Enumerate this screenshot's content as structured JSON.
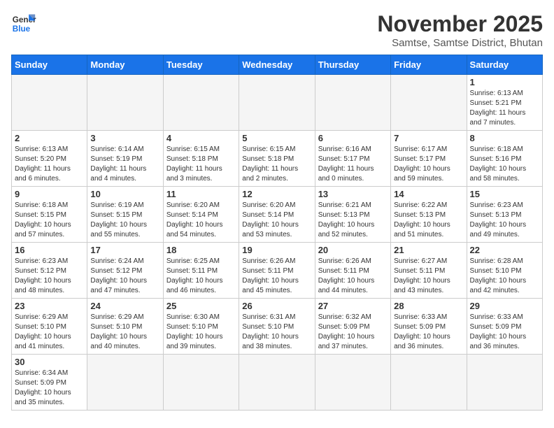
{
  "header": {
    "logo_line1": "General",
    "logo_line2": "Blue",
    "month_title": "November 2025",
    "subtitle": "Samtse, Samtse District, Bhutan"
  },
  "days_of_week": [
    "Sunday",
    "Monday",
    "Tuesday",
    "Wednesday",
    "Thursday",
    "Friday",
    "Saturday"
  ],
  "weeks": [
    [
      {
        "day": "",
        "info": ""
      },
      {
        "day": "",
        "info": ""
      },
      {
        "day": "",
        "info": ""
      },
      {
        "day": "",
        "info": ""
      },
      {
        "day": "",
        "info": ""
      },
      {
        "day": "",
        "info": ""
      },
      {
        "day": "1",
        "info": "Sunrise: 6:13 AM\nSunset: 5:21 PM\nDaylight: 11 hours\nand 7 minutes."
      }
    ],
    [
      {
        "day": "2",
        "info": "Sunrise: 6:13 AM\nSunset: 5:20 PM\nDaylight: 11 hours\nand 6 minutes."
      },
      {
        "day": "3",
        "info": "Sunrise: 6:14 AM\nSunset: 5:19 PM\nDaylight: 11 hours\nand 4 minutes."
      },
      {
        "day": "4",
        "info": "Sunrise: 6:15 AM\nSunset: 5:18 PM\nDaylight: 11 hours\nand 3 minutes."
      },
      {
        "day": "5",
        "info": "Sunrise: 6:15 AM\nSunset: 5:18 PM\nDaylight: 11 hours\nand 2 minutes."
      },
      {
        "day": "6",
        "info": "Sunrise: 6:16 AM\nSunset: 5:17 PM\nDaylight: 11 hours\nand 0 minutes."
      },
      {
        "day": "7",
        "info": "Sunrise: 6:17 AM\nSunset: 5:17 PM\nDaylight: 10 hours\nand 59 minutes."
      },
      {
        "day": "8",
        "info": "Sunrise: 6:18 AM\nSunset: 5:16 PM\nDaylight: 10 hours\nand 58 minutes."
      }
    ],
    [
      {
        "day": "9",
        "info": "Sunrise: 6:18 AM\nSunset: 5:15 PM\nDaylight: 10 hours\nand 57 minutes."
      },
      {
        "day": "10",
        "info": "Sunrise: 6:19 AM\nSunset: 5:15 PM\nDaylight: 10 hours\nand 55 minutes."
      },
      {
        "day": "11",
        "info": "Sunrise: 6:20 AM\nSunset: 5:14 PM\nDaylight: 10 hours\nand 54 minutes."
      },
      {
        "day": "12",
        "info": "Sunrise: 6:20 AM\nSunset: 5:14 PM\nDaylight: 10 hours\nand 53 minutes."
      },
      {
        "day": "13",
        "info": "Sunrise: 6:21 AM\nSunset: 5:13 PM\nDaylight: 10 hours\nand 52 minutes."
      },
      {
        "day": "14",
        "info": "Sunrise: 6:22 AM\nSunset: 5:13 PM\nDaylight: 10 hours\nand 51 minutes."
      },
      {
        "day": "15",
        "info": "Sunrise: 6:23 AM\nSunset: 5:13 PM\nDaylight: 10 hours\nand 49 minutes."
      }
    ],
    [
      {
        "day": "16",
        "info": "Sunrise: 6:23 AM\nSunset: 5:12 PM\nDaylight: 10 hours\nand 48 minutes."
      },
      {
        "day": "17",
        "info": "Sunrise: 6:24 AM\nSunset: 5:12 PM\nDaylight: 10 hours\nand 47 minutes."
      },
      {
        "day": "18",
        "info": "Sunrise: 6:25 AM\nSunset: 5:11 PM\nDaylight: 10 hours\nand 46 minutes."
      },
      {
        "day": "19",
        "info": "Sunrise: 6:26 AM\nSunset: 5:11 PM\nDaylight: 10 hours\nand 45 minutes."
      },
      {
        "day": "20",
        "info": "Sunrise: 6:26 AM\nSunset: 5:11 PM\nDaylight: 10 hours\nand 44 minutes."
      },
      {
        "day": "21",
        "info": "Sunrise: 6:27 AM\nSunset: 5:11 PM\nDaylight: 10 hours\nand 43 minutes."
      },
      {
        "day": "22",
        "info": "Sunrise: 6:28 AM\nSunset: 5:10 PM\nDaylight: 10 hours\nand 42 minutes."
      }
    ],
    [
      {
        "day": "23",
        "info": "Sunrise: 6:29 AM\nSunset: 5:10 PM\nDaylight: 10 hours\nand 41 minutes."
      },
      {
        "day": "24",
        "info": "Sunrise: 6:29 AM\nSunset: 5:10 PM\nDaylight: 10 hours\nand 40 minutes."
      },
      {
        "day": "25",
        "info": "Sunrise: 6:30 AM\nSunset: 5:10 PM\nDaylight: 10 hours\nand 39 minutes."
      },
      {
        "day": "26",
        "info": "Sunrise: 6:31 AM\nSunset: 5:10 PM\nDaylight: 10 hours\nand 38 minutes."
      },
      {
        "day": "27",
        "info": "Sunrise: 6:32 AM\nSunset: 5:09 PM\nDaylight: 10 hours\nand 37 minutes."
      },
      {
        "day": "28",
        "info": "Sunrise: 6:33 AM\nSunset: 5:09 PM\nDaylight: 10 hours\nand 36 minutes."
      },
      {
        "day": "29",
        "info": "Sunrise: 6:33 AM\nSunset: 5:09 PM\nDaylight: 10 hours\nand 36 minutes."
      }
    ],
    [
      {
        "day": "30",
        "info": "Sunrise: 6:34 AM\nSunset: 5:09 PM\nDaylight: 10 hours\nand 35 minutes."
      },
      {
        "day": "",
        "info": ""
      },
      {
        "day": "",
        "info": ""
      },
      {
        "day": "",
        "info": ""
      },
      {
        "day": "",
        "info": ""
      },
      {
        "day": "",
        "info": ""
      },
      {
        "day": "",
        "info": ""
      }
    ]
  ]
}
